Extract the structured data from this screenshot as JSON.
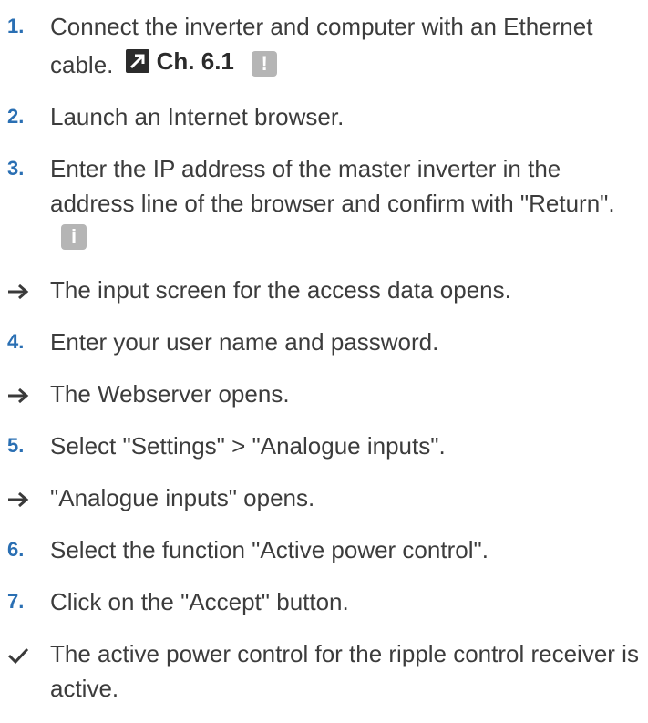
{
  "steps": [
    {
      "type": "numbered",
      "marker": "1.",
      "text": "Connect the inverter and computer with an Ethernet cable.",
      "ref": "Ch. 6.1",
      "badge": "!",
      "badge_name": "warning-icon"
    },
    {
      "type": "numbered",
      "marker": "2.",
      "text": "Launch an Internet browser."
    },
    {
      "type": "numbered",
      "marker": "3.",
      "text": "Enter the IP address of the master inverter in the address line of the browser and confirm with \"Return\".",
      "badge": "i",
      "badge_name": "info-icon"
    },
    {
      "type": "result",
      "text": "The input screen for the access data opens."
    },
    {
      "type": "numbered",
      "marker": "4.",
      "text": "Enter your user name and password."
    },
    {
      "type": "result",
      "text": "The Webserver opens."
    },
    {
      "type": "numbered",
      "marker": "5.",
      "text": "Select \"Settings\" > \"Analogue inputs\"."
    },
    {
      "type": "result",
      "text": "\"Analogue inputs\" opens."
    },
    {
      "type": "numbered",
      "marker": "6.",
      "text": "Select the function \"Active power control\"."
    },
    {
      "type": "numbered",
      "marker": "7.",
      "text": "Click on the \"Accept\" button."
    },
    {
      "type": "done",
      "text": "The active power control for the ripple control receiver is active."
    }
  ],
  "colors": {
    "step_number": "#2a6fb3",
    "body_text": "#3c3c3c",
    "badge": "#b5b5b5",
    "ref_icon": "#2b2b2b"
  }
}
